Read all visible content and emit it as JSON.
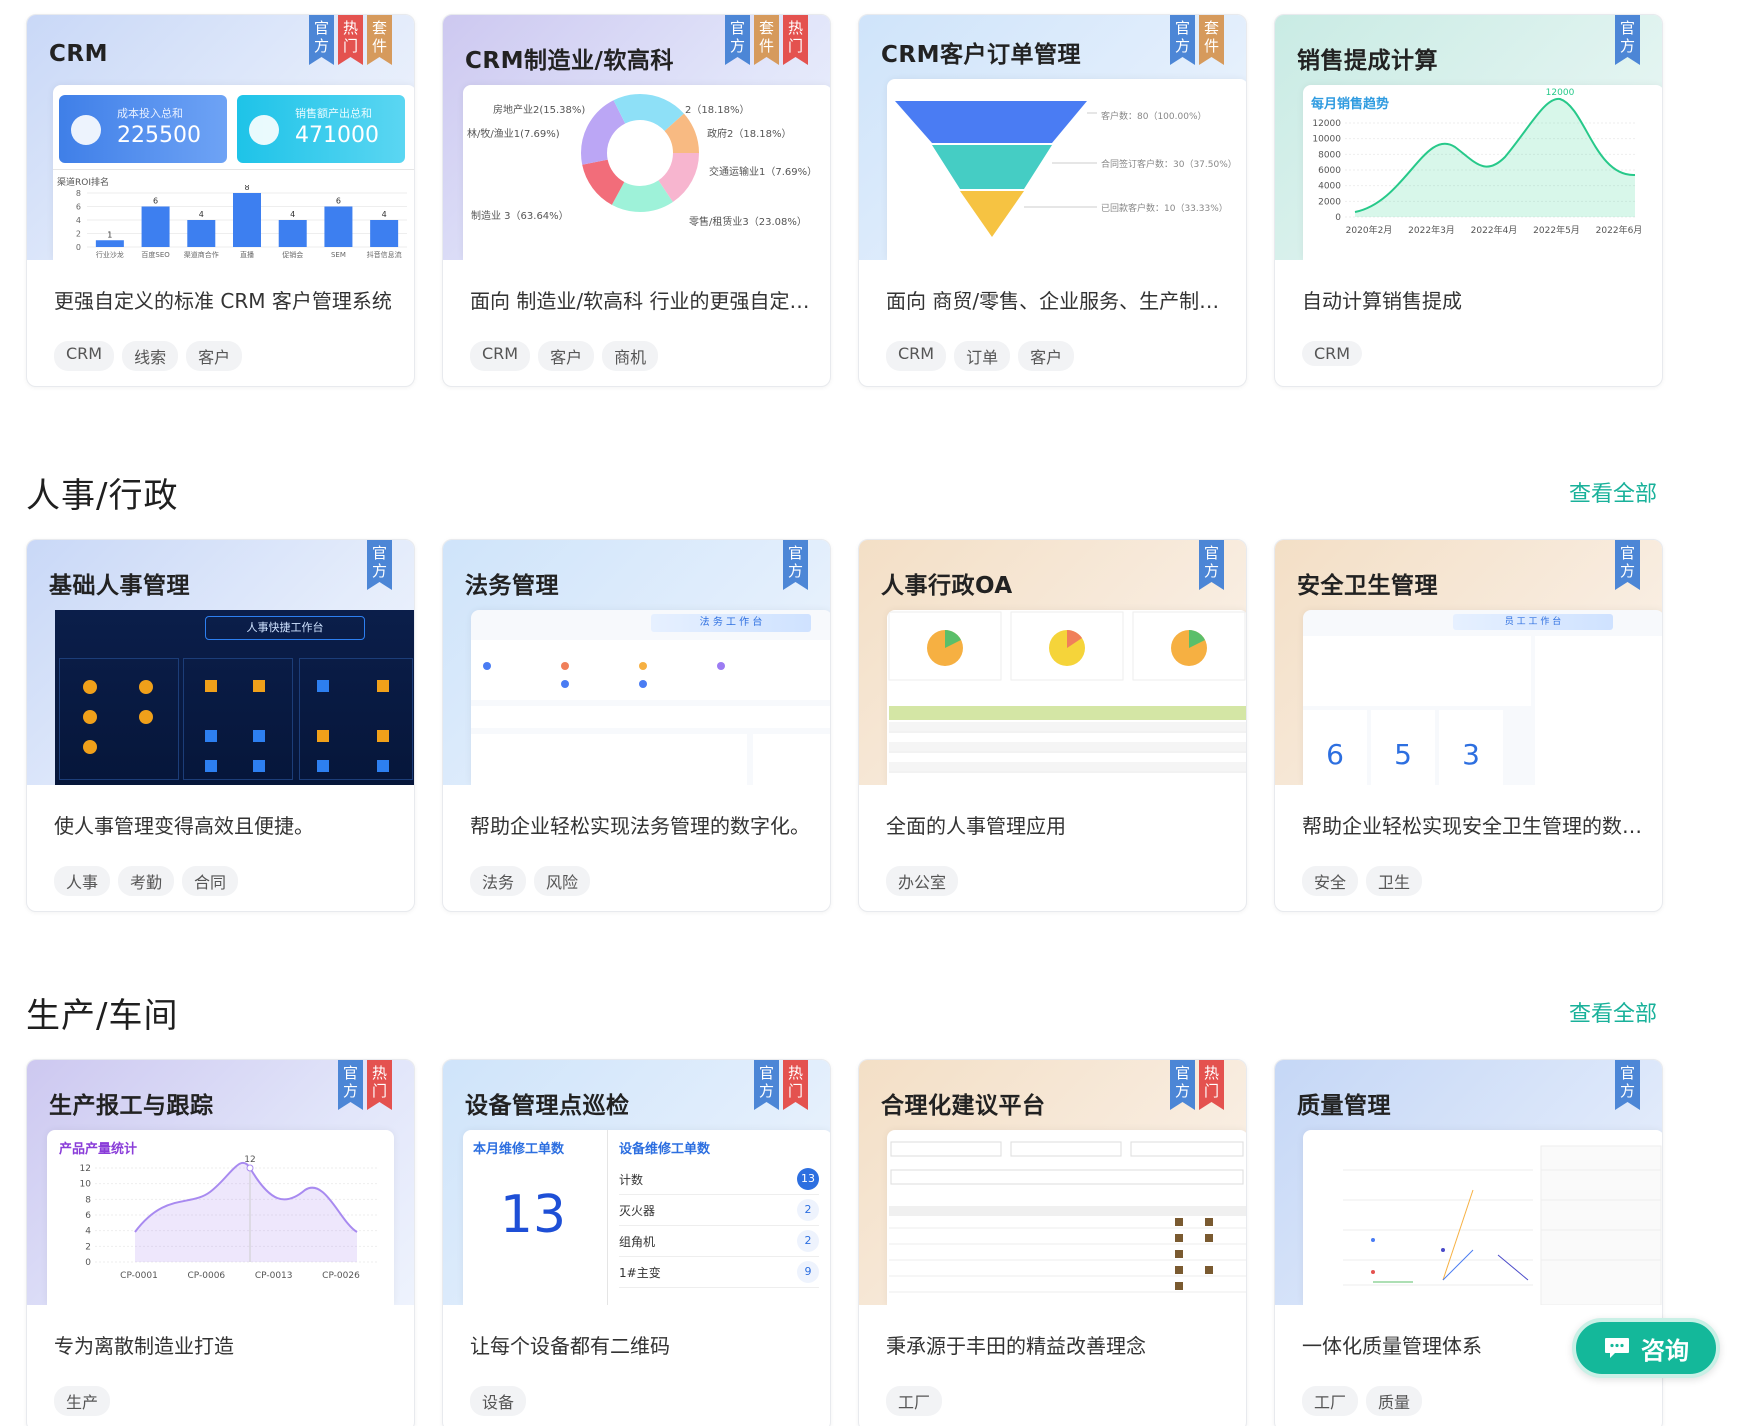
{
  "sections": [
    {
      "title": "",
      "see_all": ""
    },
    {
      "title": "人事/行政",
      "see_all": "查看全部"
    },
    {
      "title": "生产/车间",
      "see_all": "查看全部"
    }
  ],
  "badge_labels": {
    "official": "官方",
    "hot": "热门",
    "suite": "套件"
  },
  "cards": [
    {
      "title": "CRM",
      "badges": [
        "official",
        "hot",
        "suite"
      ],
      "desc": "更强自定义的标准 CRM 客户管理系统",
      "tags": [
        "CRM",
        "线索",
        "客户"
      ],
      "preview": {
        "stat1_label": "成本投入总和",
        "stat1_value": "225500",
        "stat2_label": "销售额产出总和",
        "stat2_value": "471000",
        "chart_title": "渠道ROI排名",
        "bars": [
          {
            "c": "行业沙龙",
            "v": 1
          },
          {
            "c": "百度SEO",
            "v": 6
          },
          {
            "c": "渠道商合作",
            "v": 4
          },
          {
            "c": "直播",
            "v": 8
          },
          {
            "c": "促销会",
            "v": 4
          },
          {
            "c": "SEM",
            "v": 6
          },
          {
            "c": "抖音信息流",
            "v": 4
          }
        ]
      }
    },
    {
      "title": "CRM制造业/软高科",
      "badges": [
        "official",
        "suite",
        "hot"
      ],
      "desc": "面向 制造业/软高科 行业的更强自定义的标准 CRM 客户管理系统",
      "tags": [
        "CRM",
        "客户",
        "商机"
      ],
      "preview": {
        "labels": [
          "房地产业2(15.38%)",
          "2（18.18%）",
          "林/牧/渔业1(7.69%)",
          "政府2（18.18%）",
          "交通运输业1（7.69%）",
          "制造业 3（63.64%）",
          "零售/租赁业3（23.08%）"
        ]
      }
    },
    {
      "title": "CRM客户订单管理",
      "badges": [
        "official",
        "suite"
      ],
      "desc": "面向 商贸/零售、企业服务、生产制造等行业的客户订单管理",
      "tags": [
        "CRM",
        "订单",
        "客户"
      ],
      "preview": {
        "labels": [
          "客户数：80（100.00%）",
          "合同签订客户数：30（37.50%）",
          "已回款客户数：10（33.33%）"
        ]
      }
    },
    {
      "title": "销售提成计算",
      "badges": [
        "official"
      ],
      "desc": "自动计算销售提成",
      "tags": [
        "CRM"
      ],
      "preview": {
        "chart_title": "每月销售趋势",
        "peak": "12000",
        "y_ticks": [
          "12000",
          "10000",
          "8000",
          "6000",
          "4000",
          "2000",
          "0"
        ],
        "x_ticks": [
          "2020年2月",
          "2022年3月",
          "2022年4月",
          "2022年5月",
          "2022年6月"
        ]
      }
    },
    {
      "title": "基础人事管理",
      "badges": [
        "official"
      ],
      "desc": "使人事管理变得高效且便捷。",
      "tags": [
        "人事",
        "考勤",
        "合同"
      ],
      "preview": {
        "screen_title": "人事快捷工作台"
      }
    },
    {
      "title": "法务管理",
      "badges": [
        "official"
      ],
      "desc": "帮助企业轻松实现法务管理的数字化。",
      "tags": [
        "法务",
        "风险"
      ],
      "preview": {
        "screen_title": "法 务 工 作 台"
      }
    },
    {
      "title": "人事行政OA",
      "badges": [
        "official"
      ],
      "desc": "全面的人事管理应用",
      "tags": [
        "办公室"
      ],
      "preview": {}
    },
    {
      "title": "安全卫生管理",
      "badges": [
        "official"
      ],
      "desc": "帮助企业轻松实现安全卫生管理的数字化。",
      "tags": [
        "安全",
        "卫生"
      ],
      "preview": {
        "screen_title": "员 工 工 作 台",
        "nums": [
          "6",
          "5",
          "3"
        ]
      }
    },
    {
      "title": "生产报工与跟踪",
      "badges": [
        "official",
        "hot"
      ],
      "desc": "专为离散制造业打造",
      "tags": [
        "生产"
      ],
      "preview": {
        "chart_title": "产品产量统计",
        "peak": "12",
        "y_ticks": [
          "12",
          "10",
          "8",
          "6",
          "4",
          "2",
          "0"
        ],
        "x_ticks": [
          "CP-0001",
          "CP-0006",
          "CP-0013",
          "CP-0026"
        ]
      }
    },
    {
      "title": "设备管理点巡检",
      "badges": [
        "official",
        "hot"
      ],
      "desc": "让每个设备都有二维码",
      "tags": [
        "设备"
      ],
      "preview": {
        "left_title": "本月维修工单数",
        "big": "13",
        "right_title": "设备维修工单数",
        "rows": [
          {
            "k": "计数",
            "v": "13"
          },
          {
            "k": "灭火器",
            "v": "2"
          },
          {
            "k": "组角机",
            "v": "2"
          },
          {
            "k": "1#主变",
            "v": "9"
          }
        ]
      }
    },
    {
      "title": "合理化建议平台",
      "badges": [
        "official",
        "hot"
      ],
      "desc": "秉承源于丰田的精益改善理念",
      "tags": [
        "工厂"
      ],
      "preview": {}
    },
    {
      "title": "质量管理",
      "badges": [
        "official"
      ],
      "desc": "一体化质量管理体系",
      "tags": [
        "工厂",
        "质量"
      ],
      "preview": {}
    }
  ],
  "consult_label": "咨询",
  "colors": {
    "accent": "#19b19a",
    "official": "#4c86d6",
    "hot": "#e4524f",
    "suite": "#d69a5c"
  }
}
